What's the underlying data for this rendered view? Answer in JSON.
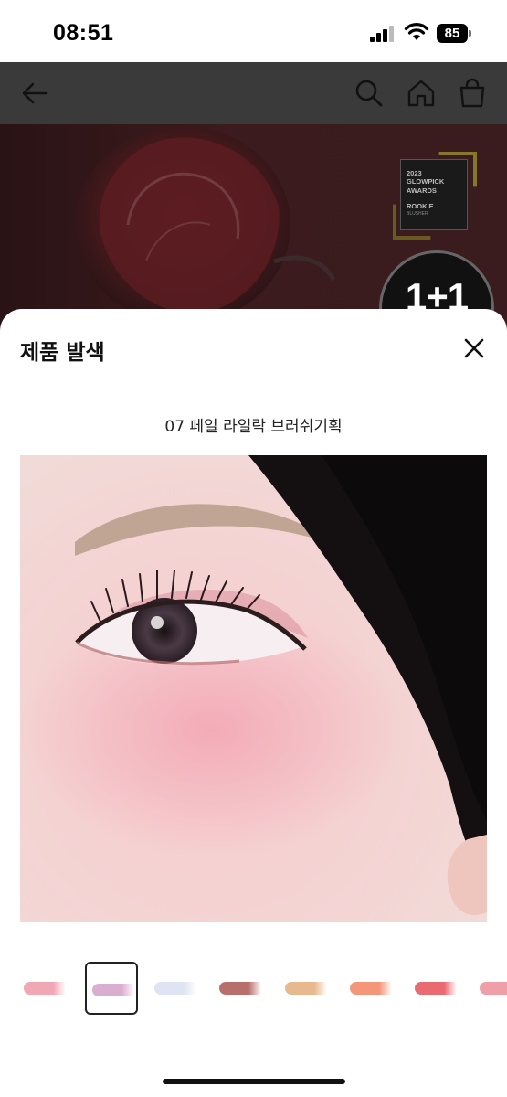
{
  "status_bar": {
    "time": "08:51",
    "battery": "85"
  },
  "header": {
    "icons": [
      "back-arrow-icon",
      "search-icon",
      "home-icon",
      "shopping-bag-icon"
    ]
  },
  "hero": {
    "award_year": "2023",
    "award_line1": "GLOWPICK",
    "award_line2": "AWARDS",
    "award_rank": "ROOKIE",
    "award_category": "BLUSHER",
    "promo": "1+1"
  },
  "sheet": {
    "title": "제품 발색",
    "shade_name": "07 페일 라일락 브러쉬기획",
    "swatch_colors": [
      "#f1a7b4",
      "#d9aed0",
      "#dfe4f3",
      "#b86f6c",
      "#e8b98e",
      "#f3967a",
      "#e96a70",
      "#ee9fa8"
    ],
    "selected_swatch": 2
  },
  "colors": {
    "header_bg": "#3a3a3a",
    "hero_bg": "#3b1b1d"
  }
}
